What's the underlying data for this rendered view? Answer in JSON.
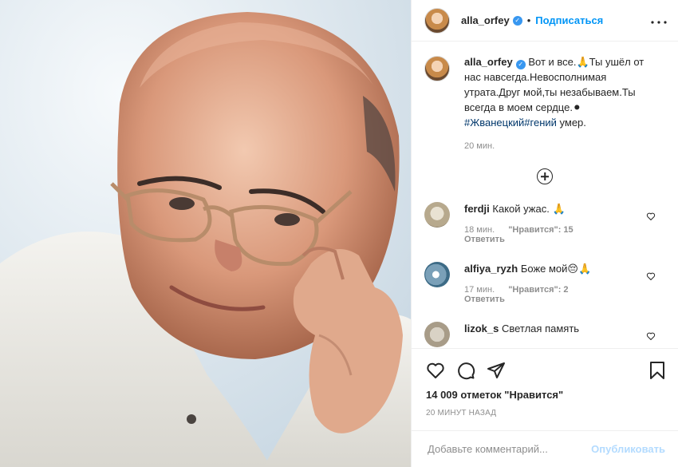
{
  "header": {
    "username": "alla_orfey",
    "separator": "•",
    "follow_label": "Подписаться",
    "more_icon": "more-horizontal-icon"
  },
  "caption": {
    "username": "alla_orfey",
    "text_1": "Вот и все.🙏Ты ушёл от нас навсегда.Невосполнимая утрата.Друг мой,ты незабываем.Ты всегда в моем сердце.⚫",
    "hashtag_1": "#Жванецкий",
    "hashtag_2": "#гений",
    "text_2": " умер.",
    "time": "20 мин."
  },
  "comments": [
    {
      "username": "ferdji",
      "text": "Какой ужас. 🙏",
      "time": "18 мин.",
      "likes": "\"Нравится\": 15",
      "reply": "Ответить"
    },
    {
      "username": "alfiya_ryzh",
      "text": "Боже мой😔🙏",
      "time": "17 мин.",
      "likes": "\"Нравится\": 2",
      "reply": "Ответить"
    },
    {
      "username": "lizok_s",
      "text": "Светлая память"
    }
  ],
  "actions": {
    "likes_count": "14 009 отметок \"Нравится\"",
    "time_ago": "20 МИНУТ НАЗАД"
  },
  "add_comment": {
    "placeholder": "Добавьте комментарий...",
    "publish_label": "Опубликовать"
  },
  "colors": {
    "accent": "#0095f6",
    "verified": "#3897f0",
    "muted": "#8e8e8e",
    "border": "#efefef"
  }
}
